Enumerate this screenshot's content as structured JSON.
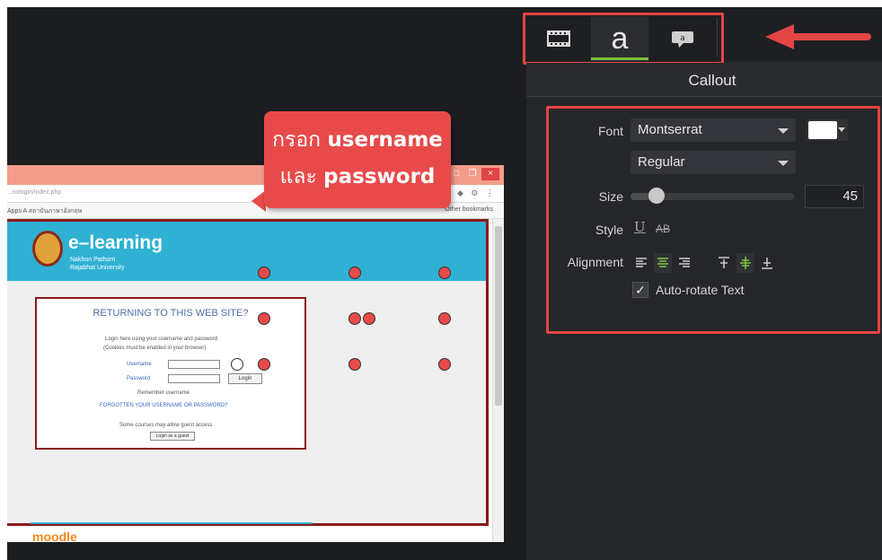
{
  "canvas": {
    "browser": {
      "window_buttons": [
        "–",
        "□",
        "❐",
        "×"
      ],
      "address_url": "...nvlogin/index.php",
      "bookmark_left": "Apps   A สถาบันภาษาอังกฤษ",
      "bookmark_right": "Other bookmarks",
      "site_title": "e–learning",
      "site_subtitle": "Nakhon Pathom Rajabhat University",
      "login_title": "RETURNING TO THIS WEB SITE?",
      "login_note1": "Login here using your username and password",
      "login_note2": "(Cookies must be enabled in your browser)",
      "username_label": "Username",
      "password_label": "Password",
      "login_button": "Login",
      "remember_label": "Remember username",
      "forgot_link": "FORGOTTEN YOUR USERNAME OR PASSWORD?",
      "cookies_note": "Some courses may allow guest access",
      "guest_button": "Login as a guest",
      "moodle_logo": "moodle"
    },
    "callout": {
      "line1_thai": "กรอก",
      "line1_bold": "username",
      "line2_thai": "และ",
      "line2_bold": "password",
      "fill_color": "#e84a4a",
      "text_color": "#ffffff"
    }
  },
  "panel": {
    "tabs": [
      {
        "name": "media",
        "icon": "filmstrip-icon"
      },
      {
        "name": "annotations",
        "icon": "annotation-a-icon",
        "label": "a",
        "active": true
      },
      {
        "name": "callout-shapes",
        "icon": "speech-bubble-icon",
        "label": "a"
      }
    ],
    "title": "Callout",
    "font_label": "Font",
    "font_value": "Montserrat",
    "font_color": "#ffffff",
    "weight_value": "Regular",
    "size_label": "Size",
    "size_value": "45",
    "style_label": "Style",
    "style_underline": "U",
    "style_strike": "AB",
    "alignment_label": "Alignment",
    "alignment_active": [
      "center",
      "middle"
    ],
    "auto_rotate_label": "Auto-rotate Text",
    "auto_rotate_checked": "✓",
    "highlight_color": "#e34545",
    "accent_color": "#7ec241"
  }
}
